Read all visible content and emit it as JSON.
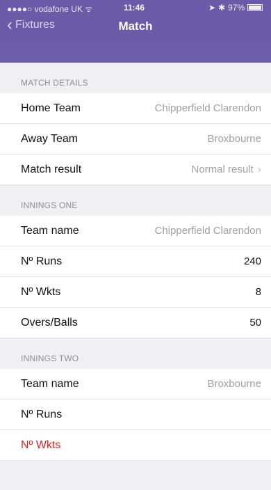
{
  "status_bar": {
    "carrier": "●●●●○ vodafone UK ᯤ",
    "time": "11:46",
    "battery": "97%"
  },
  "nav": {
    "back_label": "Fixtures",
    "title": "Match"
  },
  "sections": [
    {
      "header": "MATCH DETAILS",
      "rows": [
        {
          "label": "Home Team",
          "value": "Chipperfield Clarendon"
        },
        {
          "label": "Away Team",
          "value": "Broxbourne"
        },
        {
          "label": "Match result",
          "value": "Normal result"
        }
      ]
    },
    {
      "header": "INNINGS ONE",
      "rows": [
        {
          "label": "Team name",
          "value": "Chipperfield Clarendon"
        },
        {
          "label": "Nº Runs",
          "value": "240"
        },
        {
          "label": "Nº Wkts",
          "value": "8"
        },
        {
          "label": "Overs/Balls",
          "value": "50"
        }
      ]
    },
    {
      "header": "INNINGS TWO",
      "rows": [
        {
          "label": "Team name",
          "value": "Broxbourne"
        },
        {
          "label": "Nº Runs",
          "value": ""
        },
        {
          "label": "Nº Wkts",
          "value": ""
        }
      ]
    }
  ],
  "colors": {
    "nav_background": "#6a5aa8",
    "error_label": "#e02020"
  }
}
